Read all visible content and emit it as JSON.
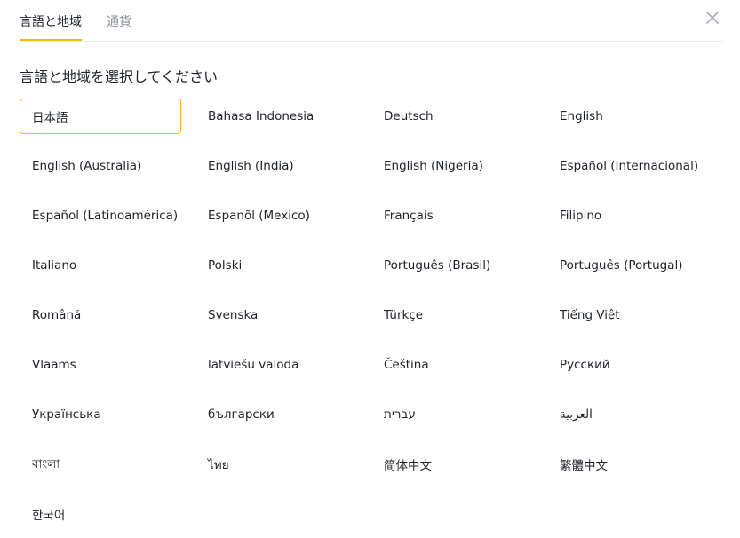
{
  "tabs": [
    {
      "label": "言語と地域",
      "active": true
    },
    {
      "label": "通貨",
      "active": false
    }
  ],
  "section_title": "言語と地域を選択してください",
  "selected_index": 0,
  "accent_color": "#f0b90b",
  "languages": [
    "日本語",
    "Bahasa Indonesia",
    "Deutsch",
    "English",
    "English (Australia)",
    "English (India)",
    "English (Nigeria)",
    "Español (Internacional)",
    "Español (Latinoamérica)",
    "Espanõl (Mexico)",
    "Français",
    "Filipino",
    "Italiano",
    "Polski",
    "Português (Brasil)",
    "Português (Portugal)",
    "Română",
    "Svenska",
    "Türkçe",
    "Tiếng Việt",
    "Vlaams",
    "latviešu valoda",
    "Čeština",
    "Русский",
    "Українська",
    "български",
    "עברית",
    "العربية",
    "বাংলা",
    "ไทย",
    "简体中文",
    "繁體中文",
    "한국어"
  ],
  "icons": {
    "close": "close-icon"
  }
}
